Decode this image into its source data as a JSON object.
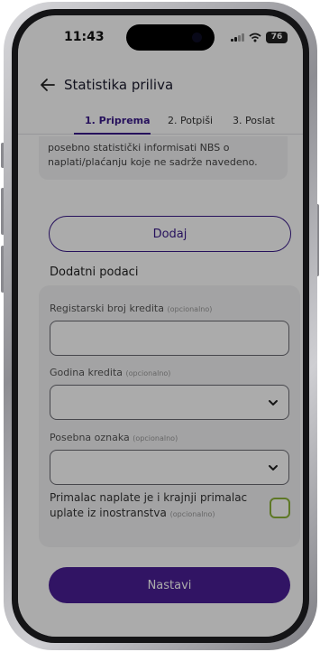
{
  "status_bar": {
    "time": "11:43",
    "battery": "76"
  },
  "header": {
    "title": "Statistika priliva"
  },
  "tabs": [
    {
      "label": "1. Priprema"
    },
    {
      "label": "2. Potpiši"
    },
    {
      "label": "3. Poslat"
    }
  ],
  "info_card": {
    "line1": "posebno statistički informisati NBS o",
    "line2": "naplati/plaćanju koje ne sadrže navedeno."
  },
  "add_button": {
    "label": "Dodaj"
  },
  "additional": {
    "title": "Dodatni podaci",
    "optional_suffix": "(opcionalno)",
    "registration": {
      "label": "Registarski broj kredita",
      "value": ""
    },
    "loan_year": {
      "label": "Godina kredita",
      "value": ""
    },
    "special_mark": {
      "label": "Posebna oznaka",
      "value": ""
    },
    "final_recipient": {
      "label": "Primalac naplate je i krajnji primalac uplate iz inostranstva",
      "checked": false
    }
  },
  "continue_button": {
    "label": "Nastavi"
  },
  "colors": {
    "primary": "#4a1e96",
    "accent_checkbox": "#8db43a"
  }
}
